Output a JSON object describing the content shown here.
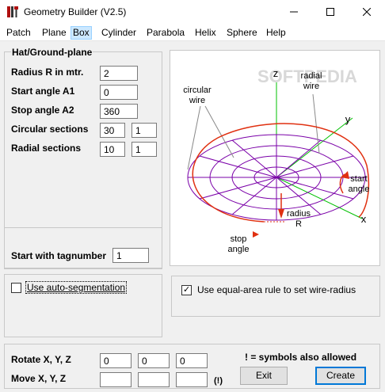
{
  "window": {
    "title": "Geometry Builder (V2.5)",
    "icon": "tools-icon",
    "controls": {
      "minimize": "minimize-icon",
      "maximize": "maximize-icon",
      "close": "close-icon"
    }
  },
  "menu": {
    "items": [
      {
        "label": "Patch"
      },
      {
        "label": "Plane"
      },
      {
        "label": "Box",
        "active": true
      },
      {
        "label": "Cylinder"
      },
      {
        "label": "Parabola"
      },
      {
        "label": "Helix"
      },
      {
        "label": "Sphere"
      },
      {
        "label": "Help"
      }
    ]
  },
  "hat_group": {
    "title": "Hat/Ground-plane",
    "radius_label": "Radius R in mtr.",
    "radius_value": "2",
    "start_angle_label": "Start angle A1",
    "start_angle_value": "0",
    "stop_angle_label": "Stop angle A2",
    "stop_angle_value": "360",
    "circular_label": "Circular sections",
    "circular_value": "30",
    "circular_value2": "1",
    "radial_label": "Radial sections",
    "radial_value": "10",
    "radial_value2": "1"
  },
  "tag_group": {
    "label": "Start with tagnumber",
    "value": "1"
  },
  "options": {
    "auto_segmentation": {
      "label": "Use auto-segmentation",
      "checked": false
    },
    "equal_area": {
      "label": "Use equal-area rule to set wire-radius",
      "checked": true
    }
  },
  "transform": {
    "rotate_label": "Rotate X, Y, Z",
    "rotate_values": [
      "0",
      "0",
      "0"
    ],
    "move_label": "Move X, Y, Z",
    "move_values": [
      "",
      "",
      ""
    ],
    "symbols_note": "! =  symbols also allowed",
    "exclaim_hint": "(!)"
  },
  "buttons": {
    "exit": "Exit",
    "create": "Create"
  },
  "diagram": {
    "watermark": "SOFTPEDIA",
    "labels": {
      "circular_wire": "circular\nwire",
      "radial_wire": "radial\nwire",
      "axis_z": "z",
      "axis_y": "y",
      "axis_x": "x",
      "start_angle": "start\nangle",
      "radius": "radius\nR",
      "stop_angle": "stop\nangle"
    },
    "colors": {
      "mesh": "#7a00a8",
      "axis": "#00c000",
      "arc": "#e03010",
      "leader": "#888888"
    }
  }
}
